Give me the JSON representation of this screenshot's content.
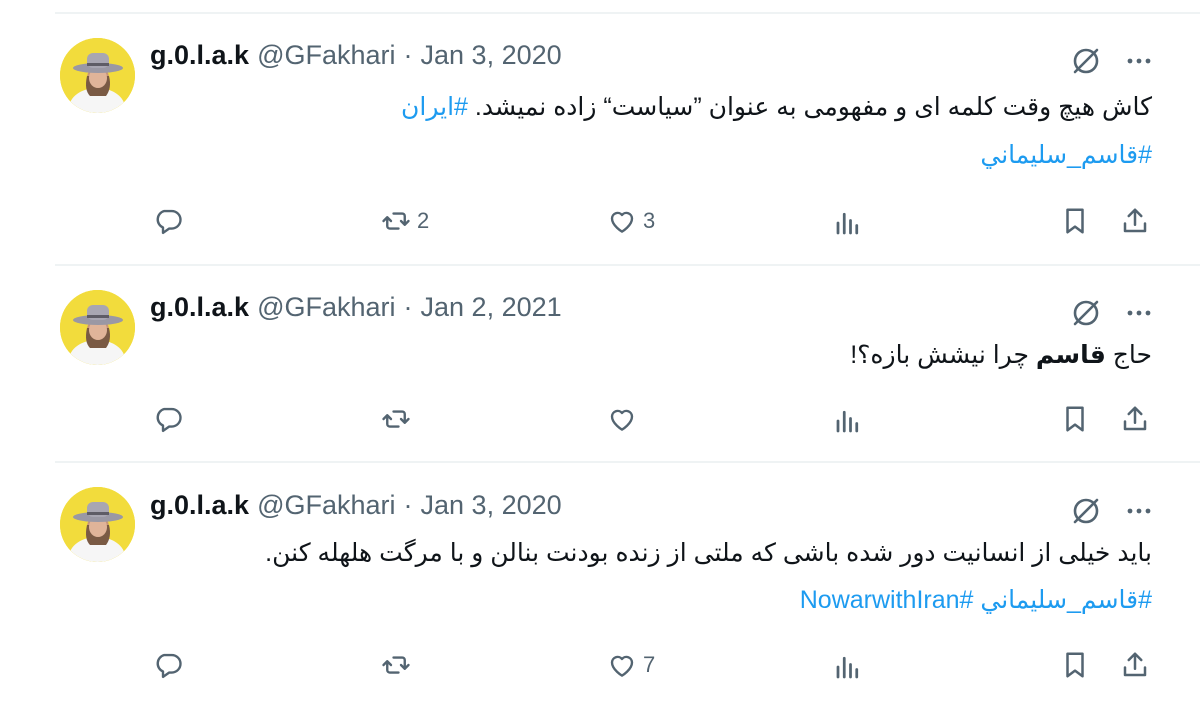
{
  "tweets": [
    {
      "name": "g.0.l.a.k",
      "handle": "@GFakhari",
      "separator": "·",
      "date": "Jan 3, 2020",
      "line1_text": "کاش هیچ وقت کلمه ای و مفهومی به عنوان ”سیاست“ زاده نمیشد.",
      "line1_hashtag": "#ایران",
      "line2_hashtag": "#قاسم_سليماني",
      "replies": "",
      "reposts": "2",
      "likes": "3"
    },
    {
      "name": "g.0.l.a.k",
      "handle": "@GFakhari",
      "separator": "·",
      "date": "Jan 2, 2021",
      "line1_pre": "حاج",
      "line1_bold": "قاسم",
      "line1_post": "چرا نیشش بازه؟!",
      "replies": "",
      "reposts": "",
      "likes": ""
    },
    {
      "name": "g.0.l.a.k",
      "handle": "@GFakhari",
      "separator": "·",
      "date": "Jan 3, 2020",
      "line1_text": "باید خیلی از انسانیت دور شده باشی که ملتی از زنده بودنت بنالن و با مرگت هلهله کنن.",
      "line2_hashtag_a": "#قاسم_سليماني",
      "line2_hashtag_b": "#NowarwithIran",
      "replies": "",
      "reposts": "",
      "likes": "7"
    }
  ],
  "icons": {
    "reply": "reply-icon",
    "repost": "repost-icon",
    "like": "like-icon",
    "views": "views-icon",
    "bookmark": "bookmark-icon",
    "share": "share-icon",
    "grok": "grok-icon",
    "more": "more-icon"
  },
  "colors": {
    "text": "#0f1419",
    "secondary": "#536471",
    "link": "#1d9bf0",
    "avatar_bg": "#f2dc3c"
  }
}
